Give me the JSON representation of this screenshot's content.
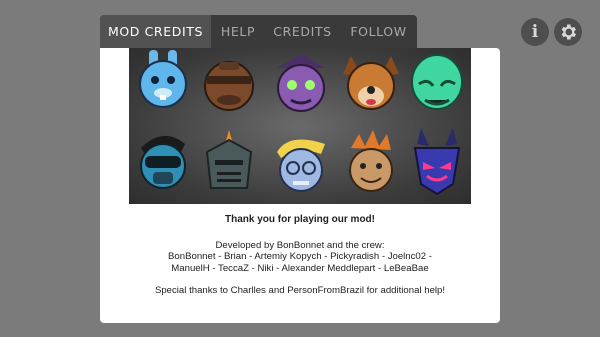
{
  "tabs": [
    {
      "label": "MOD CREDITS",
      "active": true
    },
    {
      "label": "HELP",
      "active": false
    },
    {
      "label": "CREDITS",
      "active": false
    },
    {
      "label": "FOLLOW",
      "active": false
    }
  ],
  "icons": {
    "info": "info-icon",
    "settings": "gear-icon"
  },
  "credits": {
    "thanks": "Thank you for playing our mod!",
    "developed_line": "Developed by BonBonnet and the crew:",
    "crew_line_1": "BonBonnet - Brian - Artemiy Kopych - Pickyradish - Joelnc02 -",
    "crew_line_2": "ManuelH - TeccaZ - Niki - Alexander Meddlepart - LeBeaBae",
    "special_thanks": "Special thanks to Charlles and PersonFromBrazil for additional help!"
  },
  "colors": {
    "background": "#7b7b7b",
    "tab_bar": "#3a3a3a",
    "tab_active": "#525252",
    "panel": "#ffffff"
  }
}
